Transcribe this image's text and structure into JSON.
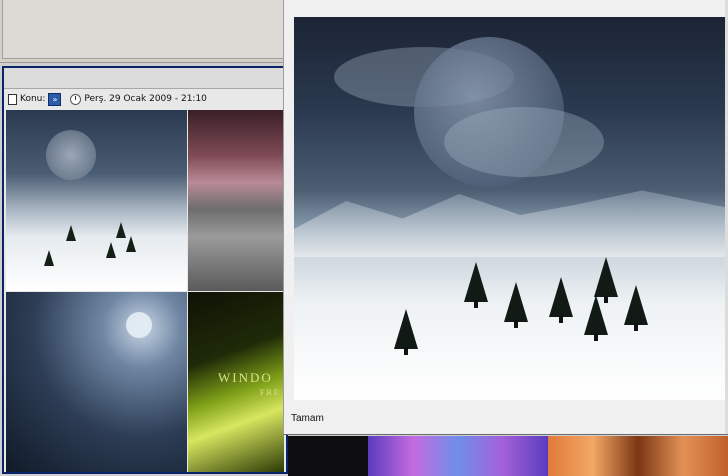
{
  "post": {
    "topic_label": "Konu:",
    "date": "Perş. 29 Ocak 2009 - 21:10",
    "tile_text": "WINDO",
    "tile_subtext": "FRE"
  },
  "dialog": {
    "ok_label": "Tamam"
  },
  "icons": [
    "document-icon",
    "go-arrow-icon",
    "clock-icon"
  ]
}
